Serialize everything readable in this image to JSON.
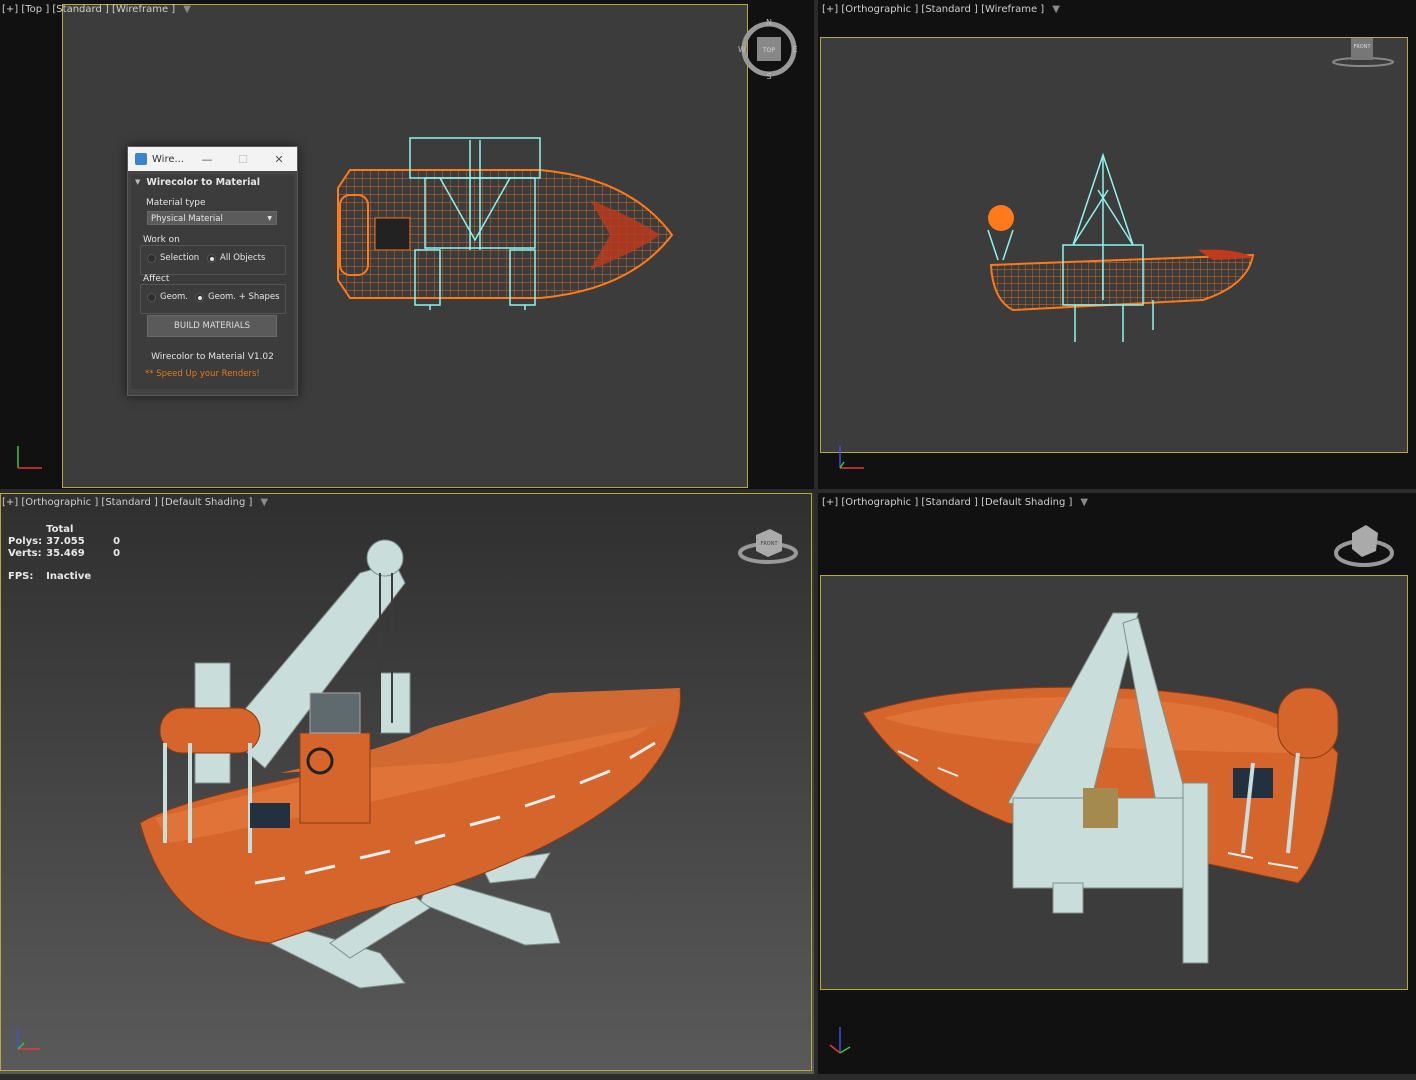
{
  "viewports": {
    "top": {
      "label": "[+] [Top ] [Standard ] [Wireframe ]",
      "cube_face": "TOP",
      "compass": {
        "n": "N",
        "w": "W",
        "e": "E",
        "s": "S"
      }
    },
    "right_top": {
      "label": "[+] [Orthographic ] [Standard ] [Wireframe ]",
      "cube_face": "FRONT"
    },
    "bottom_left": {
      "label": "[+] [Orthographic ] [Standard ] [Default Shading ]",
      "cube_face": "FRONT"
    },
    "bottom_right": {
      "label": "[+] [Orthographic ] [Standard ] [Default Shading ]"
    }
  },
  "stats": {
    "total_header": "Total",
    "polys_label": "Polys:",
    "polys_value": "37.055",
    "polys_sel": "0",
    "verts_label": "Verts:",
    "verts_value": "35.469",
    "verts_sel": "0",
    "fps_label": "FPS:",
    "fps_value": "Inactive"
  },
  "dialog": {
    "title": "Wire...",
    "rollout": "Wirecolor to Material",
    "material_type_label": "Material type",
    "material_type_value": "Physical Material",
    "work_on_label": "Work on",
    "work_on_options": [
      "Selection",
      "All Objects"
    ],
    "work_on_selected": "All Objects",
    "affect_label": "Affect",
    "affect_options": [
      "Geom.",
      "Geom. + Shapes"
    ],
    "affect_selected": "Geom. + Shapes",
    "build_button": "BUILD MATERIALS",
    "version": "Wirecolor to Material V1.02",
    "tagline": "** Speed Up your Renders!"
  },
  "colors": {
    "boat": "#d5652a",
    "crane": "#c9dedb",
    "wire_orange": "#ff7a1a",
    "wire_cyan": "#8ff3ee",
    "safe_frame": "#b7a83a"
  }
}
